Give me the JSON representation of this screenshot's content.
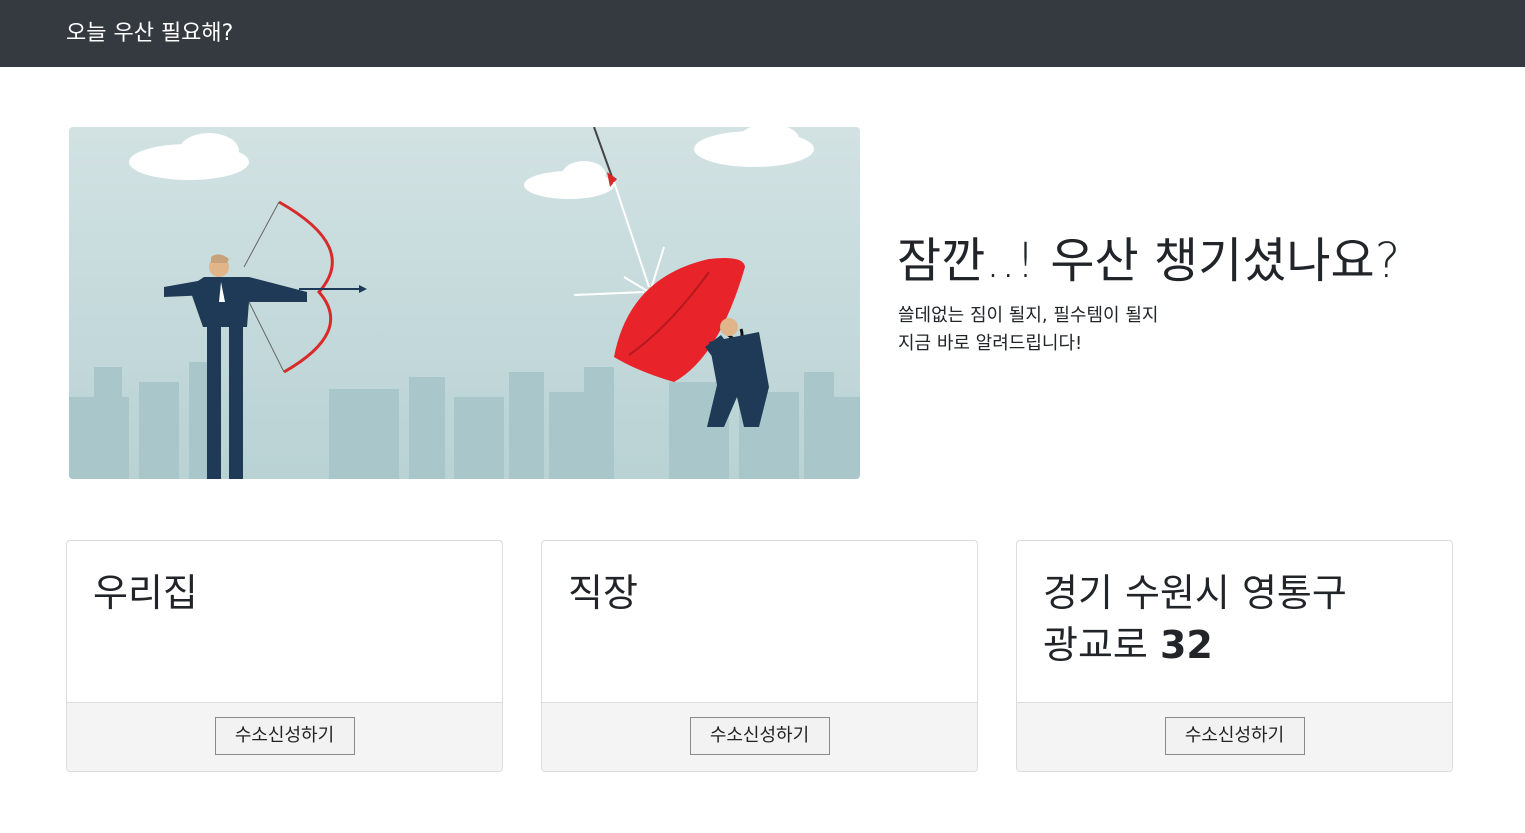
{
  "navbar": {
    "brand": "오늘 우산 필요해?"
  },
  "hero": {
    "headline": "잠깐..! 우산 챙기셨나요?",
    "sub_line1": "쓸데없는 짐이 될지, 필수템이 될지",
    "sub_line2": "지금 바로 알려드립니다!",
    "illustration": "archer-shooting-arrow-at-umbrella"
  },
  "cards": [
    {
      "title": "우리집",
      "button": "수소신성하기"
    },
    {
      "title": "직장",
      "button": "수소신성하기"
    },
    {
      "title_line1": "경기 수원시 영통구",
      "title_line2_text": "광교로 ",
      "title_line2_num": "32",
      "button": "수소신성하기"
    }
  ],
  "colors": {
    "navbar": "#343a40",
    "umbrella": "#e8232a",
    "sky": "#cfe0e1",
    "suit": "#1f3a56"
  }
}
